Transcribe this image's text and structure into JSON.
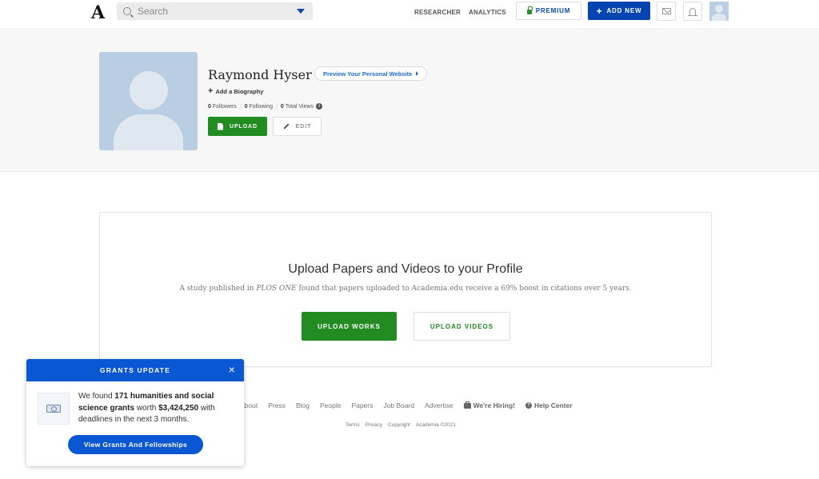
{
  "topbar": {
    "logo": "A",
    "search_placeholder": "Search",
    "nav_links": [
      "RESEARCHER",
      "ANALYTICS"
    ],
    "premium_label": "PREMIUM",
    "add_new_label": "ADD NEW",
    "icons": [
      "mail-icon",
      "bell-icon",
      "avatar"
    ]
  },
  "profile": {
    "name": "Raymond Hyser",
    "preview_website_label": "Preview Your Personal Website",
    "add_biography_label": "Add a Biography",
    "stats": {
      "followers_count": "0",
      "followers_label": "Followers",
      "following_count": "0",
      "following_label": "Following",
      "views_count": "0",
      "views_label": "Total Views"
    },
    "upload_label": "UPLOAD",
    "edit_label": "EDIT"
  },
  "upload_card": {
    "title": "Upload Papers and Videos to your Profile",
    "subtitle_pre": "A study published in ",
    "subtitle_journal": "PLOS ONE",
    "subtitle_post": " found that papers uploaded to Academia.edu receive a 69% boost in citations over 5 years.",
    "upload_works_label": "UPLOAD WORKS",
    "upload_videos_label": "UPLOAD VIDEOS"
  },
  "footer": {
    "links": [
      "About",
      "Press",
      "Blog",
      "People",
      "Papers",
      "Job Board",
      "Advertise"
    ],
    "hiring_label": "We're Hiring!",
    "help_label": "Help Center",
    "legal": [
      "Terms",
      "Privacy",
      "Copyright",
      "Academia ©2021"
    ]
  },
  "grants_popup": {
    "title": "GRANTS UPDATE",
    "close_symbol": "×",
    "text_pre": "We found ",
    "text_bold1": "171 humanities and social science grants",
    "text_mid": " worth ",
    "text_bold2": "$3,424,250",
    "text_post": " with deadlines in the next 3 months.",
    "cta_label": "View Grants And Fellowships"
  },
  "colors": {
    "brand_blue": "#0645b1",
    "popup_blue": "#0a57d3",
    "green": "#228b22",
    "avatar_placeholder": "#b9cde3",
    "band_gray": "#f7f7f7"
  }
}
